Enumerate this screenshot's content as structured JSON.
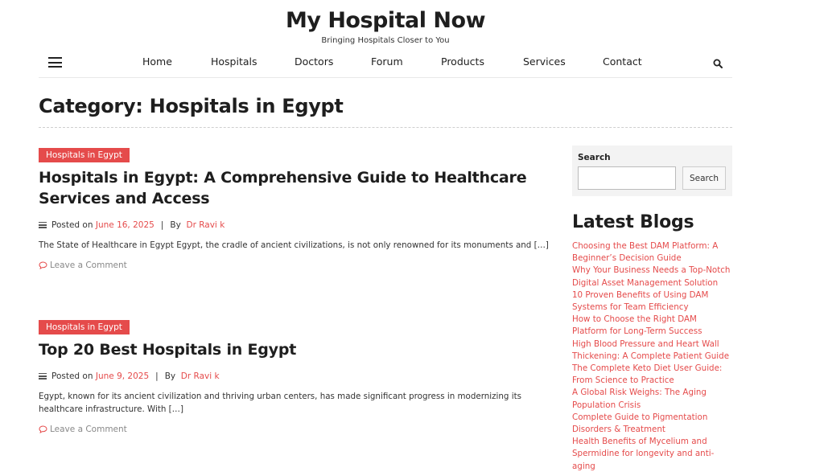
{
  "site": {
    "title": "My Hospital Now",
    "tagline": "Bringing Hospitals Closer to You"
  },
  "nav": {
    "menu_icon": "hamburger-icon",
    "items": [
      "Home",
      "Hospitals",
      "Doctors",
      "Forum",
      "Products",
      "Services",
      "Contact"
    ],
    "search_icon": "search-icon"
  },
  "category_title": "Category: Hospitals in Egypt",
  "posts": [
    {
      "category": "Hospitals in Egypt",
      "title": "Hospitals in Egypt: A Comprehensive Guide to Healthcare Services and Access",
      "posted_on": "Posted on",
      "date": "June 16, 2025",
      "by": "By",
      "author": "Dr Ravi k",
      "excerpt": "The State of Healthcare in Egypt Egypt, the cradle of ancient civilizations, is not only renowned for its monuments and […]",
      "comment": "Leave a Comment"
    },
    {
      "category": "Hospitals in Egypt",
      "title": "Top 20 Best Hospitals in Egypt",
      "posted_on": "Posted on",
      "date": "June 9, 2025",
      "by": "By",
      "author": "Dr Ravi k",
      "excerpt": "Egypt, known for its ancient civilization and thriving urban centers, has made significant progress in modernizing its healthcare infrastructure. With […]",
      "comment": "Leave a Comment"
    }
  ],
  "sidebar": {
    "search_label": "Search",
    "search_button": "Search",
    "search_value": "",
    "latest_title": "Latest Blogs",
    "latest_items": [
      "Choosing the Best DAM Platform: A Beginner’s Decision Guide",
      "Why Your Business Needs a Top-Notch Digital Asset Management Solution",
      "10 Proven Benefits of Using DAM Systems for Team Efficiency",
      "How to Choose the Right DAM Platform for Long-Term Success",
      "High Blood Pressure and Heart Wall Thickening: A Complete Patient Guide",
      "The Complete Keto Diet User Guide: From Science to Practice",
      "A Global Risk Weighs: The Aging Population Crisis",
      "Complete Guide to Pigmentation Disorders & Treatment",
      "Health Benefits of Mycelium and Spermidine for longevity and anti-aging"
    ]
  },
  "colors": {
    "accent": "#e54b4b",
    "text": "#1e1e1e"
  }
}
